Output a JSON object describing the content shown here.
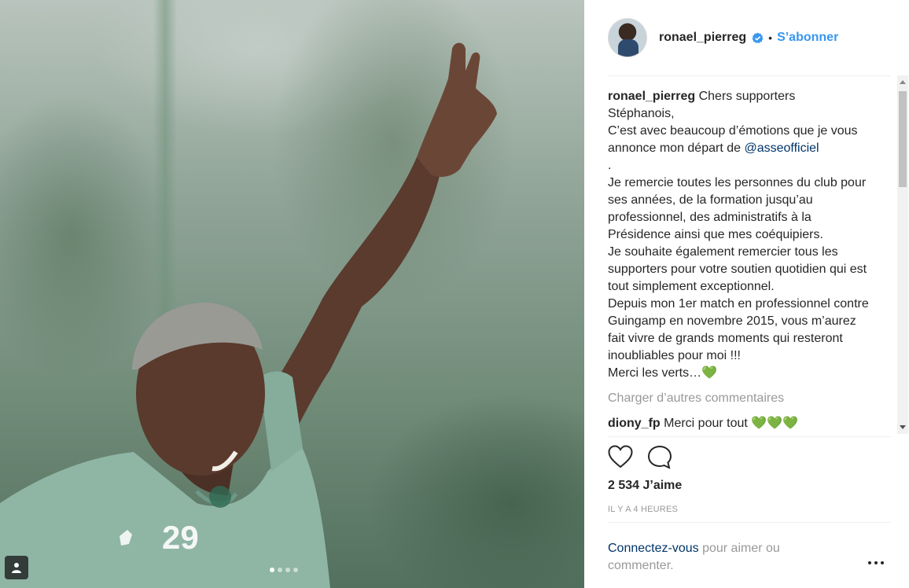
{
  "post": {
    "username": "ronael_pierreg",
    "separator": "•",
    "follow_label": "S’abonner",
    "caption": {
      "author": "ronael_pierreg",
      "text_before_mention": " Chers supporters\nStéphanois,\nC’est avec beaucoup d’émotions que je vous annonce mon départ de ",
      "mention": "@asseofficiel",
      "text_after_mention": "\n.\nJe remercie toutes les personnes du club pour ses années, de la formation jusqu’au professionnel, des administratifs à la Présidence ainsi que mes coéquipiers.\nJe souhaite également remercier tous les supporters pour votre soutien quotidien qui est tout simplement exceptionnel.\nDepuis mon 1er match en professionnel contre Guingamp en novembre 2015, vous m’aurez fait vivre de grands moments qui resteront inoubliables pour moi !!!\nMerci les verts…",
      "emoji": "💚"
    },
    "load_more_label": "Charger d’autres commentaires",
    "comments": [
      {
        "author": "diony_fp",
        "text": " Merci pour tout ",
        "emoji": "💚💚💚"
      }
    ],
    "likes_label": "2 534 J’aime",
    "time_label": "IL Y A 4 HEURES",
    "login_link": "Connectez-vous",
    "login_text": " pour aimer ou commenter.",
    "photo": {
      "jersey_number": "29",
      "carousel_count": 4,
      "carousel_active": 1
    }
  },
  "colors": {
    "link_blue": "#3897f0",
    "mention_blue": "#003569",
    "muted": "#999999",
    "heart_green": "#3cc51d"
  },
  "icons": {
    "verified": "verified-badge-icon",
    "like": "heart-outline-icon",
    "comment": "comment-bubble-icon",
    "more": "ellipsis-icon",
    "multi_user": "user-tag-icon"
  }
}
